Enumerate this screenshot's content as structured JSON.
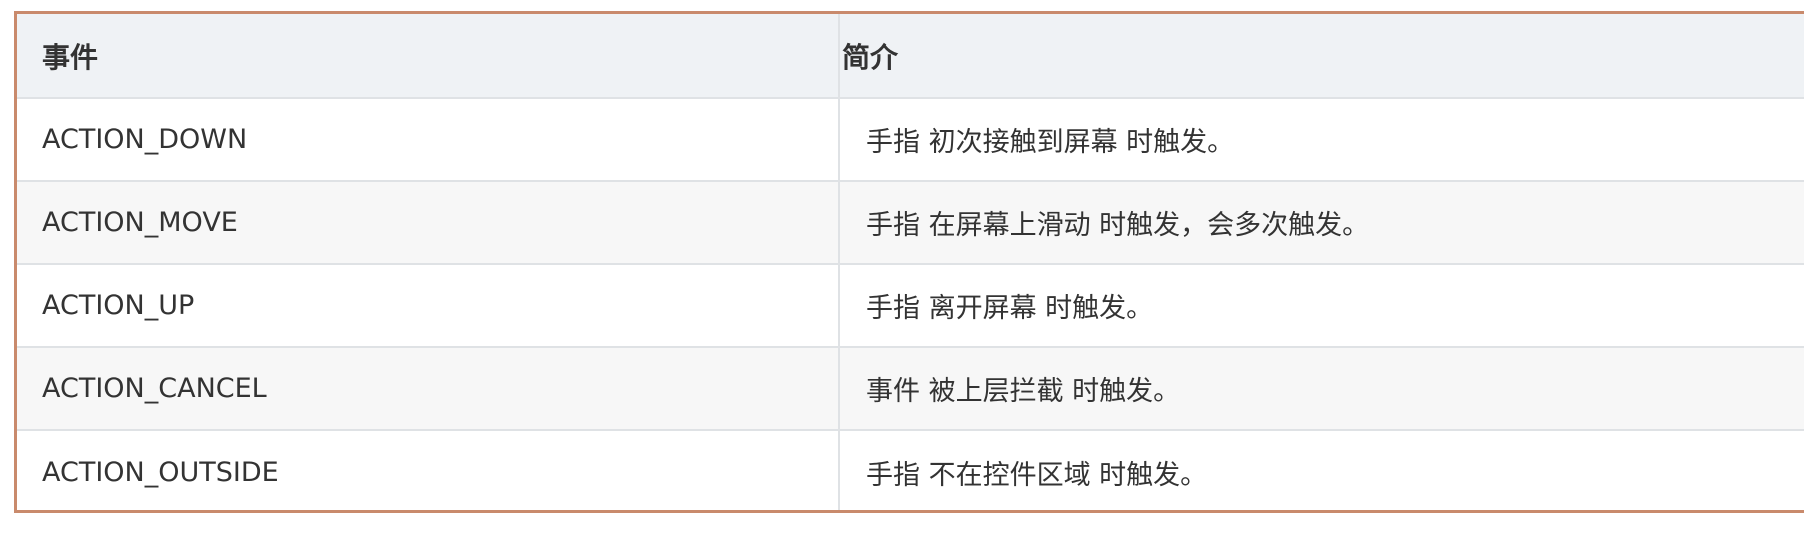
{
  "table": {
    "headers": {
      "event": "事件",
      "description": "简介"
    },
    "rows": [
      {
        "event": "ACTION_DOWN",
        "description": "手指 初次接触到屏幕 时触发。"
      },
      {
        "event": "ACTION_MOVE",
        "description": "手指 在屏幕上滑动 时触发，会多次触发。"
      },
      {
        "event": "ACTION_UP",
        "description": "手指 离开屏幕 时触发。"
      },
      {
        "event": "ACTION_CANCEL",
        "description": "事件 被上层拦截 时触发。"
      },
      {
        "event": "ACTION_OUTSIDE",
        "description": "手指 不在控件区域 时触发。"
      }
    ]
  },
  "colors": {
    "frame_border": "#c98a6c",
    "header_background": "#eff2f5",
    "alt_row_background": "#f7f7f7",
    "grid_line": "#dfe2e5",
    "text": "#333333"
  }
}
